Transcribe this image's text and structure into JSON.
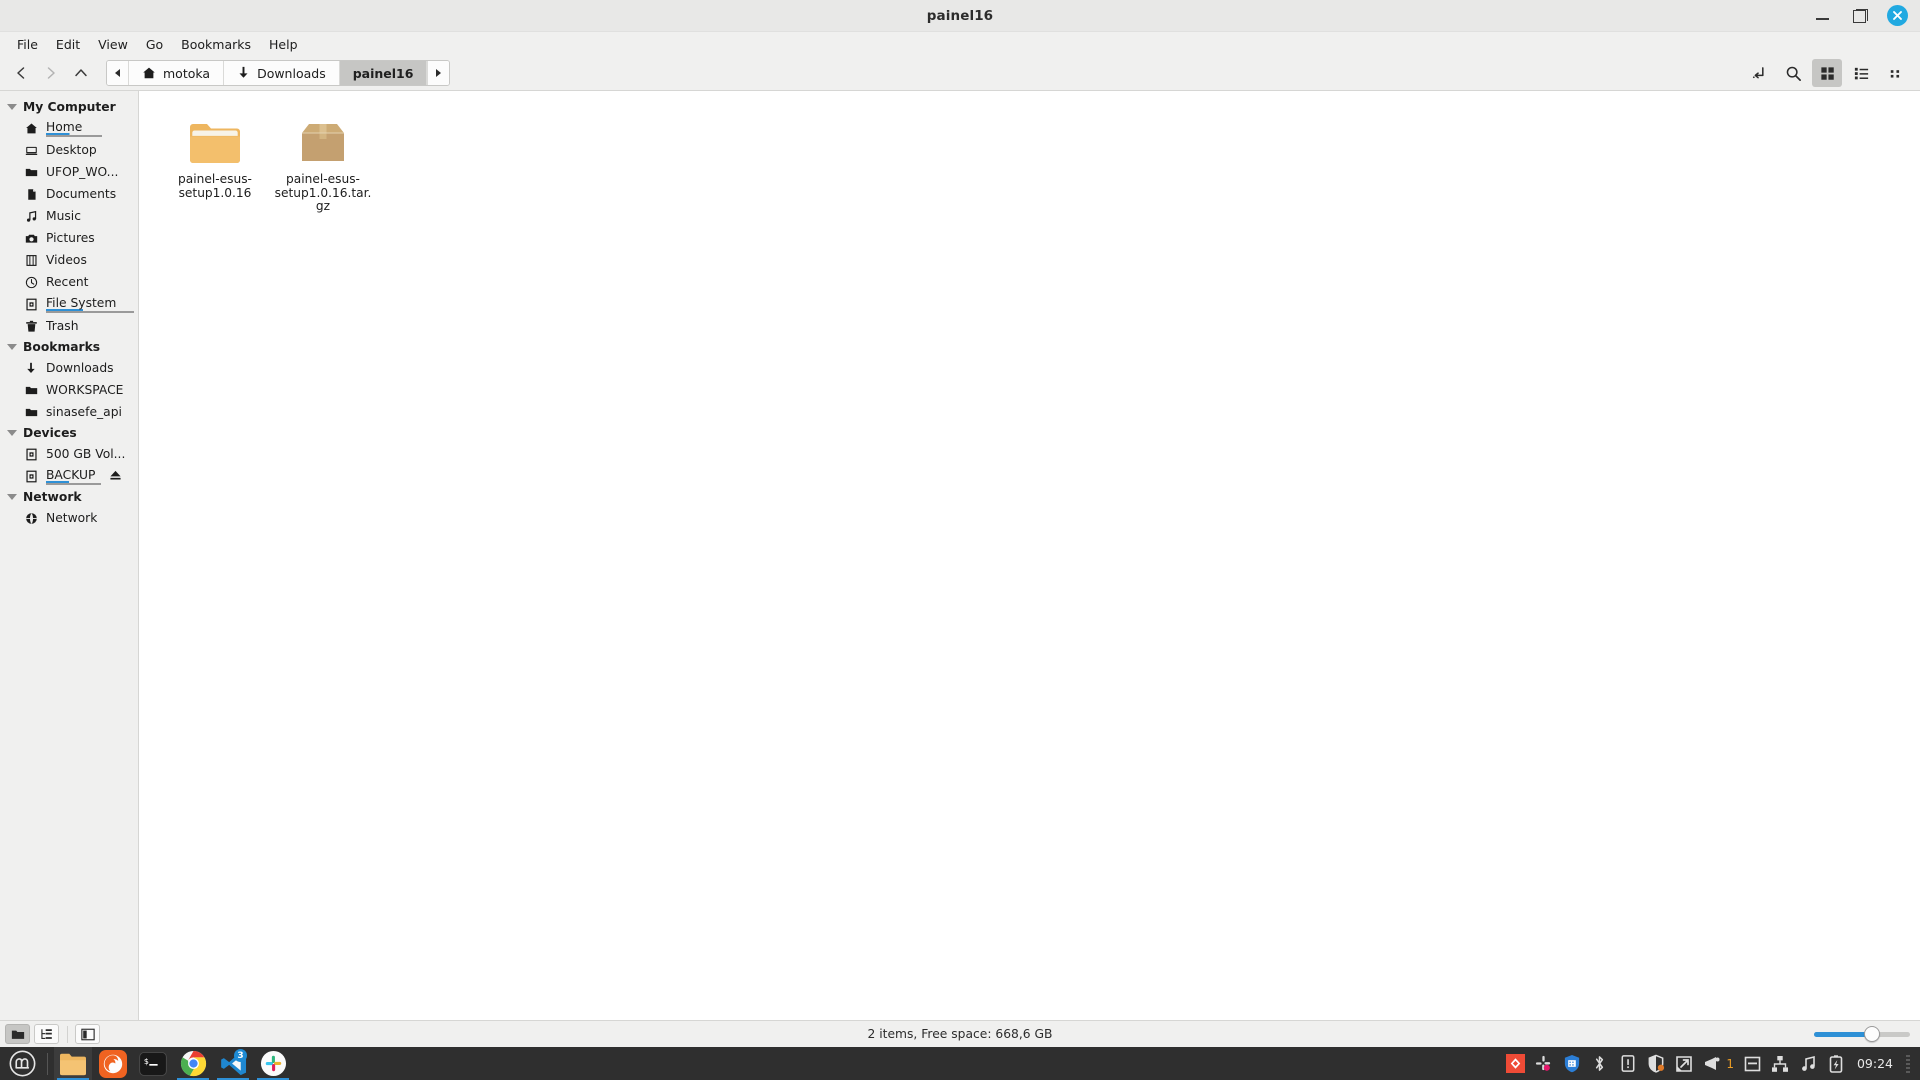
{
  "window": {
    "title": "painel16",
    "minimize_label": "Minimize",
    "maximize_label": "Maximize",
    "close_label": "Close"
  },
  "menubar": {
    "items": [
      {
        "label": "File"
      },
      {
        "label": "Edit"
      },
      {
        "label": "View"
      },
      {
        "label": "Go"
      },
      {
        "label": "Bookmarks"
      },
      {
        "label": "Help"
      }
    ]
  },
  "toolbar": {
    "back_label": "Back",
    "forward_label": "Forward",
    "up_label": "Open parent folder",
    "path_entry_label": "Toggle location entry",
    "search_label": "Search",
    "icon_view_label": "Icon view",
    "list_view_label": "List view",
    "compact_view_label": "Compact view",
    "active_view": "icon-view"
  },
  "pathbar": {
    "scroll_left_label": "Scroll left",
    "scroll_right_label": "Scroll right",
    "crumbs": [
      {
        "label": "motoka",
        "icon": "home-icon",
        "active": false
      },
      {
        "label": "Downloads",
        "icon": "download-icon",
        "active": false
      },
      {
        "label": "painel16",
        "icon": "",
        "active": true
      }
    ]
  },
  "sidebar": {
    "groups": [
      {
        "title": "My Computer",
        "items": [
          {
            "label": "Home",
            "icon": "home-icon",
            "highlighted": true
          },
          {
            "label": "Desktop",
            "icon": "desktop-icon",
            "highlighted": false
          },
          {
            "label": "UFOP_WO...",
            "icon": "folder-icon",
            "highlighted": false
          },
          {
            "label": "Documents",
            "icon": "document-icon",
            "highlighted": false
          },
          {
            "label": "Music",
            "icon": "music-icon",
            "highlighted": false
          },
          {
            "label": "Pictures",
            "icon": "camera-icon",
            "highlighted": false
          },
          {
            "label": "Videos",
            "icon": "film-icon",
            "highlighted": false
          },
          {
            "label": "Recent",
            "icon": "clock-icon",
            "highlighted": false
          },
          {
            "label": "File System",
            "icon": "drive-icon",
            "highlighted": true
          },
          {
            "label": "Trash",
            "icon": "trash-icon",
            "highlighted": false
          }
        ]
      },
      {
        "title": "Bookmarks",
        "items": [
          {
            "label": "Downloads",
            "icon": "download-icon",
            "highlighted": false
          },
          {
            "label": "WORKSPACE",
            "icon": "folder-icon",
            "highlighted": false
          },
          {
            "label": "sinasefe_api",
            "icon": "folder-icon",
            "highlighted": false
          }
        ]
      },
      {
        "title": "Devices",
        "items": [
          {
            "label": "500 GB Vol...",
            "icon": "drive-icon",
            "highlighted": false
          },
          {
            "label": "BACKUP",
            "icon": "drive-icon",
            "highlighted": true,
            "eject": true
          }
        ]
      },
      {
        "title": "Network",
        "items": [
          {
            "label": "Network",
            "icon": "globe-icon",
            "highlighted": false
          }
        ]
      }
    ]
  },
  "files": [
    {
      "name": "painel-esus-setup1.0.16",
      "type": "folder",
      "icon": "folder-icon"
    },
    {
      "name": "painel-esus-setup1.0.16.tar.gz",
      "type": "archive",
      "icon": "archive-box-icon"
    }
  ],
  "statusbar": {
    "text": "2 items, Free space: 668,6 GB",
    "shortcuts_label": "Shortcuts view",
    "tree_label": "Tree view",
    "sidepane_label": "Toggle side pane",
    "zoom_value": 60
  },
  "taskbar": {
    "menu_label": "Menu",
    "apps": [
      {
        "name": "file-manager",
        "label": "Files",
        "running": true,
        "active": true,
        "badge": ""
      },
      {
        "name": "firefox",
        "label": "Firefox",
        "running": false,
        "active": false,
        "badge": ""
      },
      {
        "name": "terminal",
        "label": "Terminal",
        "running": false,
        "active": false,
        "badge": ""
      },
      {
        "name": "chrome",
        "label": "Google Chrome",
        "running": true,
        "active": false,
        "badge": ""
      },
      {
        "name": "vscode",
        "label": "Visual Studio Code",
        "running": true,
        "active": false,
        "badge": "3"
      },
      {
        "name": "slack",
        "label": "Slack",
        "running": true,
        "active": false,
        "badge": ""
      }
    ],
    "tray": [
      {
        "name": "anydesk-icon",
        "label": "AnyDesk"
      },
      {
        "name": "slack-tray-icon",
        "label": "Slack"
      },
      {
        "name": "shield-icon",
        "label": "Firewall"
      },
      {
        "name": "bluetooth-icon",
        "label": "Bluetooth"
      },
      {
        "name": "update-manager-icon",
        "label": "Update Manager"
      },
      {
        "name": "security-shield-icon",
        "label": "Security"
      },
      {
        "name": "display-icon",
        "label": "Display"
      },
      {
        "name": "notifications-icon",
        "label": "Notifications",
        "count": "1"
      },
      {
        "name": "clipboard-icon",
        "label": "Clipboard"
      },
      {
        "name": "network-icon",
        "label": "Network"
      },
      {
        "name": "sound-icon",
        "label": "Sound"
      },
      {
        "name": "battery-icon",
        "label": "Battery"
      }
    ],
    "clock": "09:24"
  },
  "colors": {
    "accent": "#2e90d6",
    "chrome_bg": "#f0f0ef",
    "titlebar_bg": "#e8e8e7",
    "taskbar_bg": "#2f2f2f",
    "folder": "#f2bd6a",
    "archive": "#c8a471"
  }
}
